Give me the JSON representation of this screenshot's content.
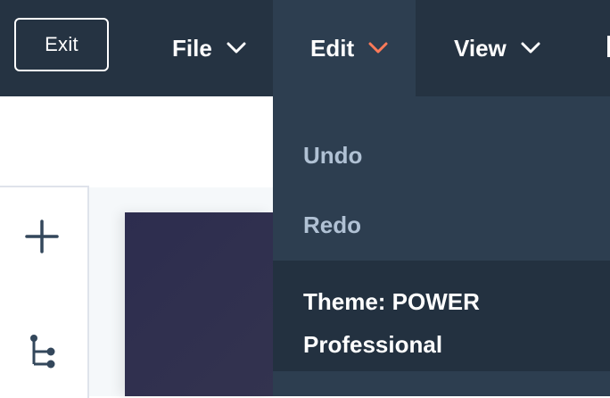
{
  "toolbar": {
    "exit_label": "Exit",
    "menus": [
      {
        "label": "File"
      },
      {
        "label": "Edit"
      },
      {
        "label": "View"
      }
    ]
  },
  "edit_menu": {
    "items": [
      {
        "label": "Undo",
        "enabled": false
      },
      {
        "label": "Redo",
        "enabled": false
      },
      {
        "label_line1": "Theme: POWER",
        "label_line2": "Professional",
        "enabled": true
      }
    ]
  },
  "sidebar": {
    "icons": [
      "plus-icon",
      "tree-icon"
    ]
  },
  "colors": {
    "topbar": "#253342",
    "dropdown": "#2d3e50",
    "highlight": "#233140",
    "accent_chevron": "#ff7a59",
    "disabled_text": "#b0c1d4"
  }
}
